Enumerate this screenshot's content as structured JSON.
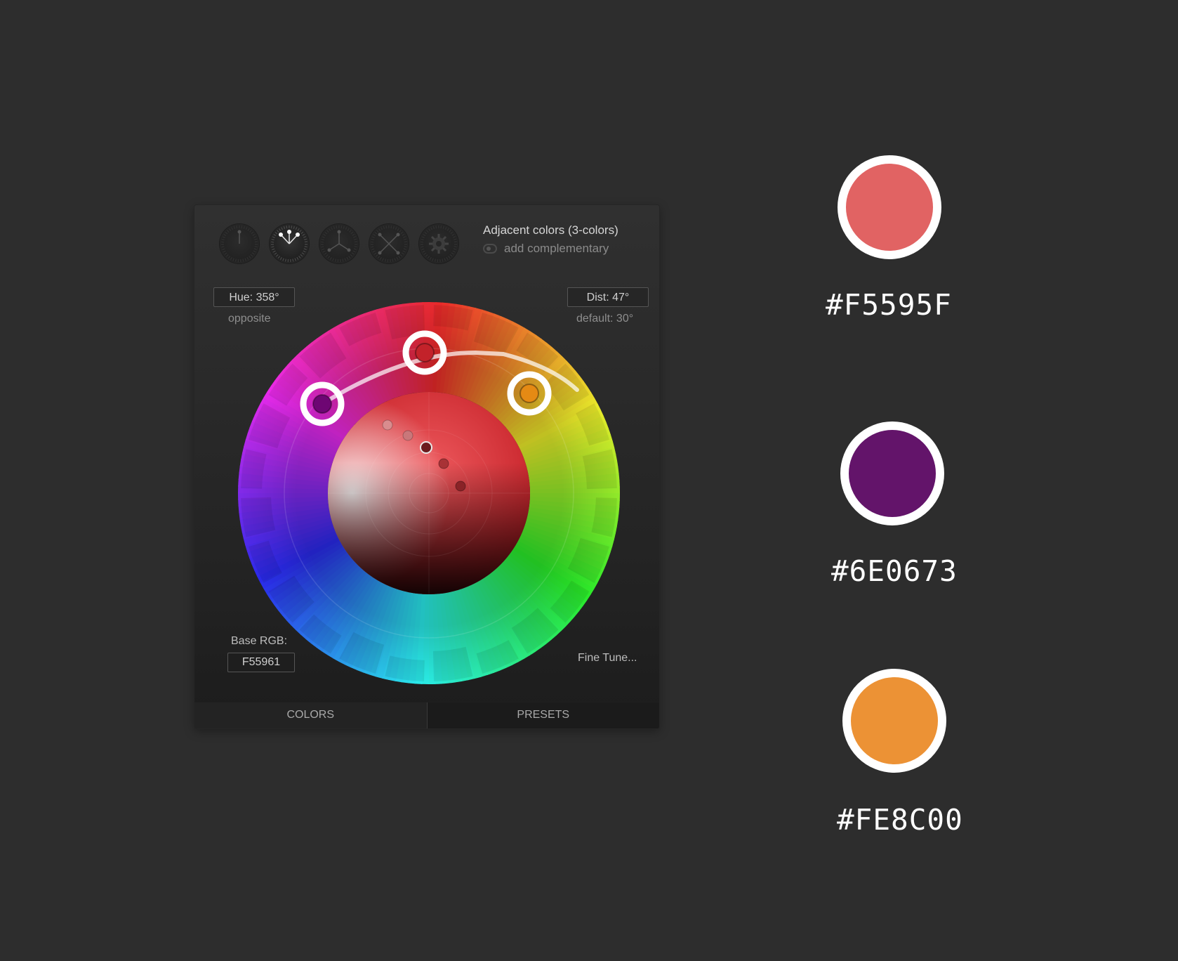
{
  "wheel": {
    "mode_buttons": [
      {
        "name": "mono-mode-button",
        "icon": "mono-icon",
        "active": false
      },
      {
        "name": "adjacent-mode-button",
        "icon": "adjacent-icon",
        "active": true
      },
      {
        "name": "triad-mode-button",
        "icon": "triad-icon",
        "active": false
      },
      {
        "name": "tetrad-mode-button",
        "icon": "tetrad-icon",
        "active": false
      },
      {
        "name": "custom-mode-button",
        "icon": "gear-icon",
        "active": false
      }
    ],
    "scheme_title": "Adjacent colors (3-colors)",
    "add_complementary": "add complementary",
    "hue_value": "Hue: 358°",
    "hue_sub": "opposite",
    "dist_value": "Dist: 47°",
    "dist_sub": "default: 30°",
    "base_rgb_label": "Base RGB:",
    "base_rgb_value": "F55961",
    "fine_tune": "Fine Tune...",
    "tabs": [
      "COLORS",
      "PRESETS"
    ],
    "handle_colors": [
      "#6e0673",
      "#c3222a",
      "#e58a14"
    ]
  },
  "swatches": [
    {
      "hex": "#F5595F",
      "color": "#e16363"
    },
    {
      "hex": "#6E0673",
      "color": "#63146a"
    },
    {
      "hex": "#FE8C00",
      "color": "#ec9235"
    }
  ]
}
